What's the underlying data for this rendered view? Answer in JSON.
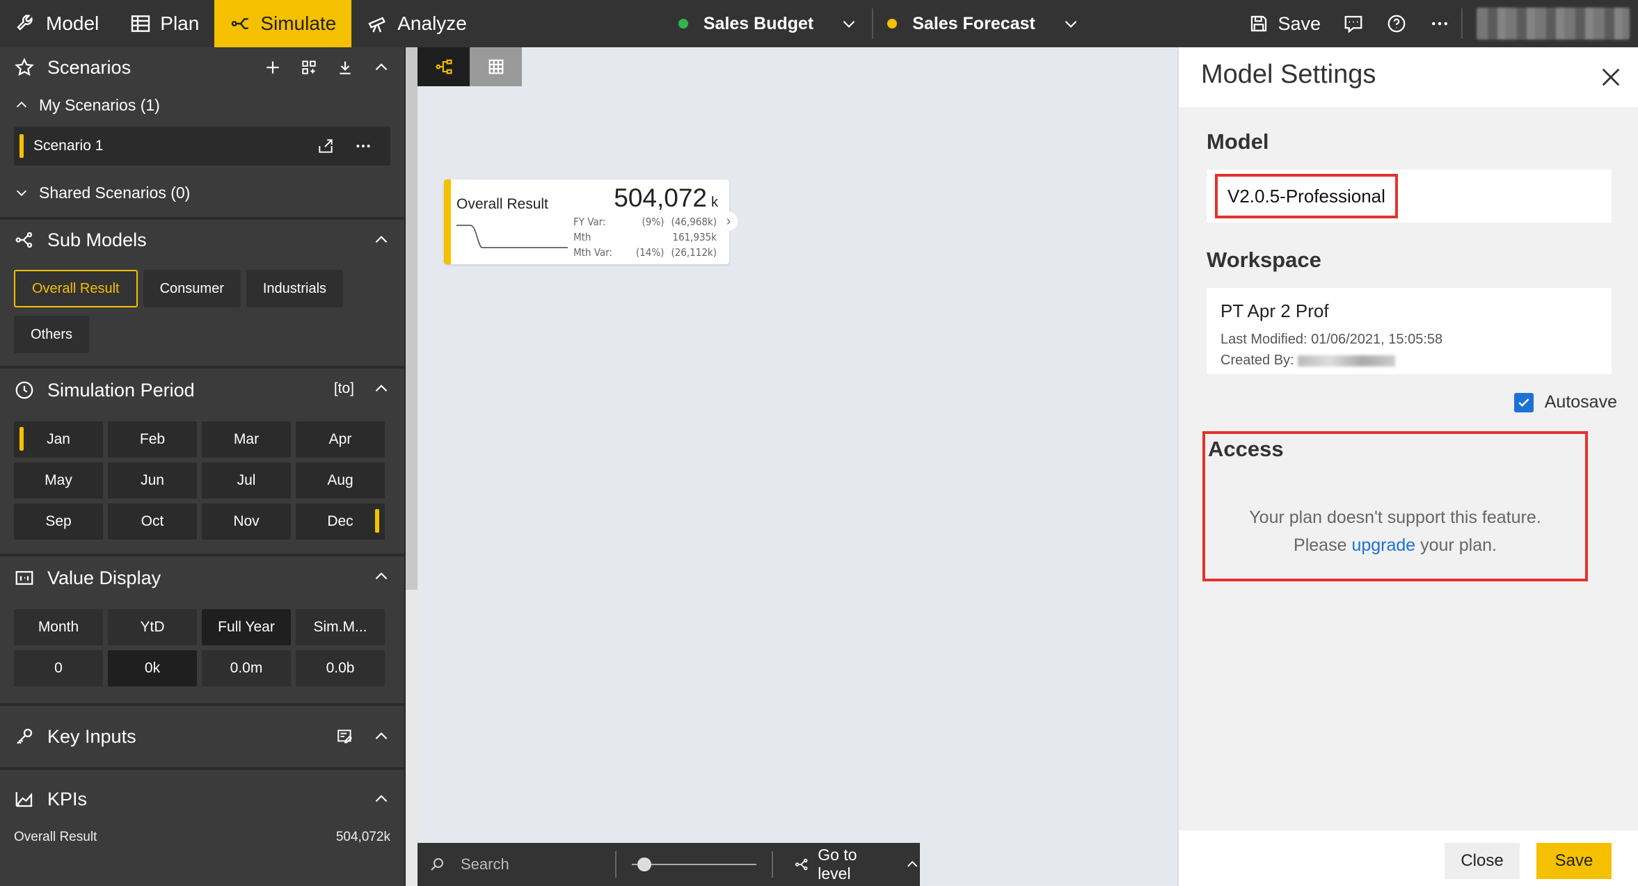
{
  "topbar": {
    "tabs": [
      {
        "label": "Model",
        "icon": "wrench-icon"
      },
      {
        "label": "Plan",
        "icon": "table-icon"
      },
      {
        "label": "Simulate",
        "icon": "branch-icon"
      },
      {
        "label": "Analyze",
        "icon": "telescope-icon"
      }
    ],
    "scenario_a": {
      "label": "Sales Budget",
      "color": "#2eb84b"
    },
    "scenario_b": {
      "label": "Sales Forecast",
      "color": "#f5c000"
    },
    "save_label": "Save"
  },
  "sidebar": {
    "scenarios": {
      "title": "Scenarios",
      "my_label": "My Scenarios (1)",
      "items": [
        "Scenario 1"
      ],
      "shared_label": "Shared Scenarios (0)"
    },
    "submodels": {
      "title": "Sub Models",
      "chips": [
        "Overall Result",
        "Consumer",
        "Industrials",
        "Others"
      ]
    },
    "period": {
      "title": "Simulation Period",
      "range_tag": "[to]",
      "months": [
        "Jan",
        "Feb",
        "Mar",
        "Apr",
        "May",
        "Jun",
        "Jul",
        "Aug",
        "Sep",
        "Oct",
        "Nov",
        "Dec"
      ]
    },
    "value_display": {
      "title": "Value Display",
      "modes": [
        "Month",
        "YtD",
        "Full Year",
        "Sim.M..."
      ],
      "units": [
        "0",
        "0k",
        "0.0m",
        "0.0b"
      ]
    },
    "key_inputs": {
      "title": "Key Inputs"
    },
    "kpis": {
      "title": "KPIs",
      "first_label": "Overall Result",
      "first_value": "504,072k"
    }
  },
  "canvas": {
    "node": {
      "title": "Overall Result",
      "value": "504,072",
      "unit": "k",
      "rows": [
        {
          "label": "FY Var:",
          "pct": "(9%)",
          "val": "(46,968k)"
        },
        {
          "label": "Mth",
          "pct": "",
          "val": "161,935k"
        },
        {
          "label": "Mth Var:",
          "pct": "(14%)",
          "val": "(26,112k)"
        }
      ]
    },
    "bottom": {
      "search_placeholder": "Search",
      "goto_label": "Go to level"
    }
  },
  "panel": {
    "title": "Model Settings",
    "model_label": "Model",
    "model_value": "V2.0.5-Professional",
    "workspace_label": "Workspace",
    "workspace_name": "PT Apr 2 Prof",
    "last_modified": "Last Modified: 01/06/2021, 15:05:58",
    "created_by": "Created By:",
    "autosave_label": "Autosave",
    "access_label": "Access",
    "access_line1": "Your plan doesn't support this feature.",
    "access_line2_pre": "Please",
    "access_link": "upgrade",
    "access_line2_post": "your plan.",
    "close_label": "Close",
    "save_label": "Save"
  },
  "colors": {
    "accent": "#f5c000",
    "dark": "#333333",
    "highlight": "#e5322d",
    "link": "#1c72d4"
  }
}
